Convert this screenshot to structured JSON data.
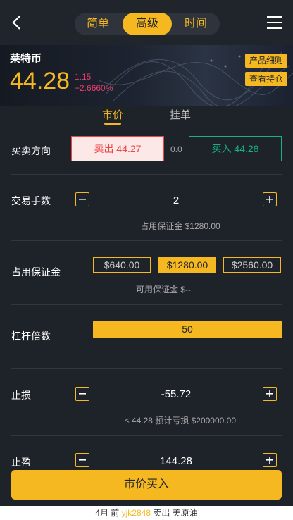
{
  "header": {
    "tabs": [
      {
        "label": "简单",
        "active": false
      },
      {
        "label": "高级",
        "active": true
      },
      {
        "label": "时间",
        "active": false
      }
    ]
  },
  "banner": {
    "product_name": "莱特币",
    "price": "44.28",
    "change_abs": "1.15",
    "change_pct": "+2.6660%",
    "rules_button": "产品细则",
    "positions_button": "查看持仓"
  },
  "order_tabs": [
    {
      "label": "市价",
      "active": true
    },
    {
      "label": "挂单",
      "active": false
    }
  ],
  "direction": {
    "label": "买卖方向",
    "sell_label": "卖出 44.27",
    "spread": "0.0",
    "buy_label": "买入 44.28"
  },
  "lots": {
    "label": "交易手数",
    "value": "2",
    "hint": "占用保证金 $1280.00"
  },
  "margin": {
    "label": "占用保证金",
    "options": [
      "$640.00",
      "$1280.00",
      "$2560.00"
    ],
    "selected": "$1280.00",
    "hint": "可用保证金 $--"
  },
  "leverage": {
    "label": "杠杆倍数",
    "value": "50"
  },
  "stop_loss": {
    "label": "止损",
    "value": "-55.72",
    "hint": "≤ 44.28 预计亏损 $200000.00"
  },
  "take_profit": {
    "label": "止盈",
    "value": "144.28"
  },
  "submit_label": "市价买入",
  "ticker": {
    "prefix": "4月 前 ",
    "user": "yjk2848",
    "suffix": " 卖出 美原油"
  },
  "colors": {
    "accent": "#f5b820",
    "sell": "#ee4444",
    "buy": "#17b37e",
    "change": "#e83e6c",
    "background": "#1e2229"
  }
}
